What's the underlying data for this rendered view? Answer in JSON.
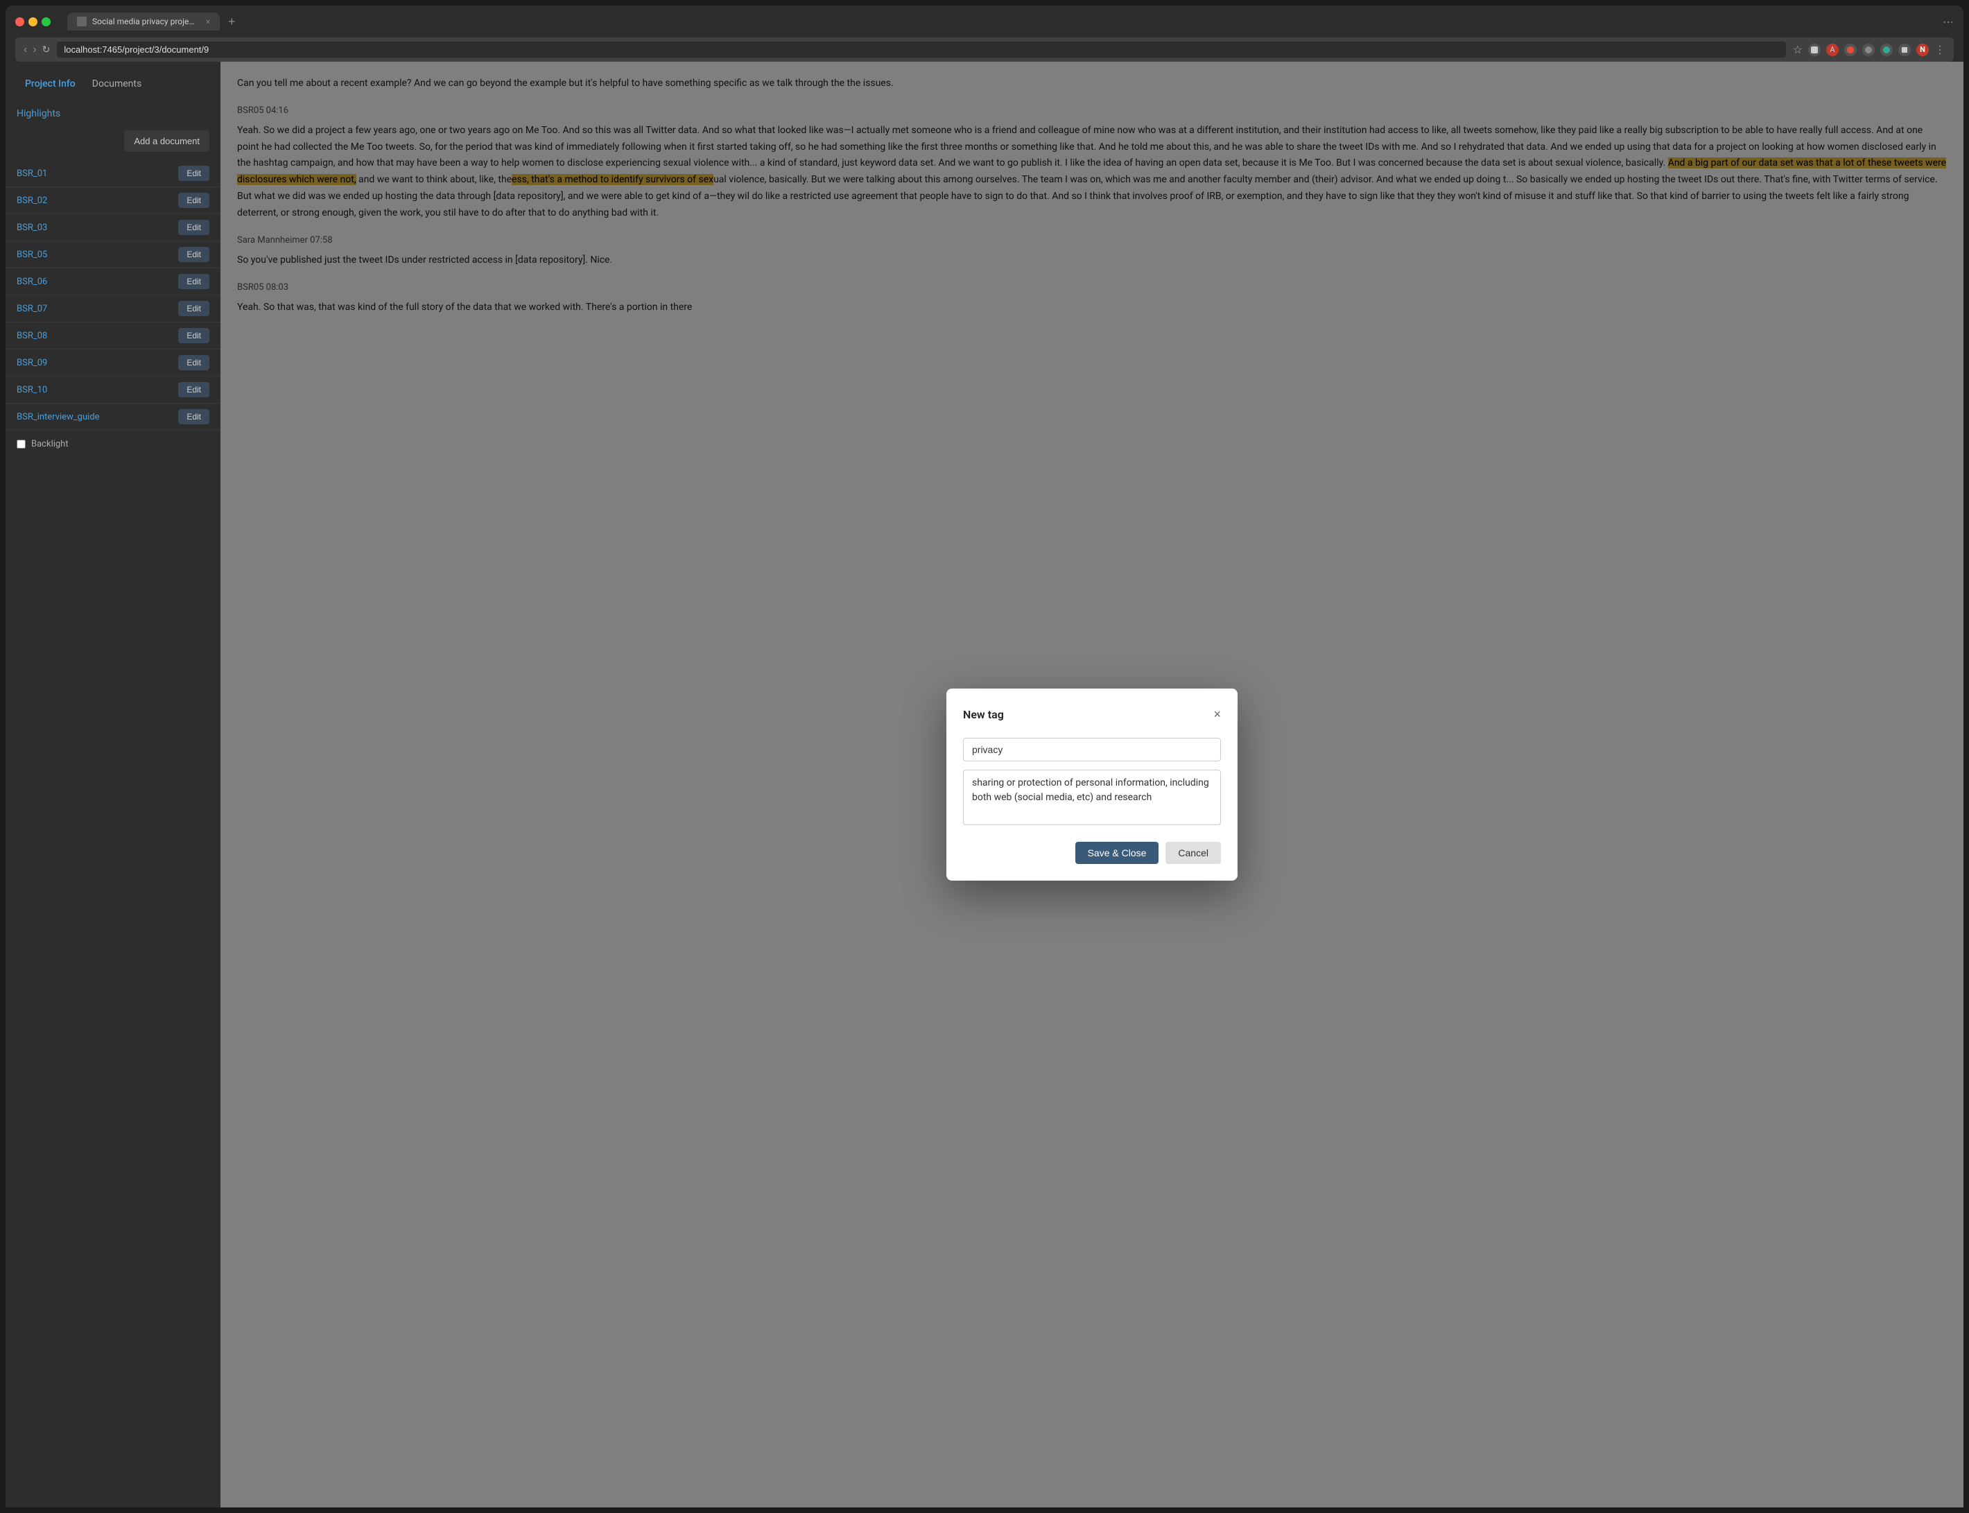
{
  "browser": {
    "tab_title": "Social media privacy project |",
    "url": "localhost:7465/project/3/document/9",
    "tab_close_label": "×",
    "tab_new_label": "+",
    "more_label": "⋯",
    "nav_back": "‹",
    "nav_forward": "›",
    "nav_refresh": "↻",
    "bookmark_label": "☆",
    "avatar_label": "N"
  },
  "sidebar": {
    "nav_project_info": "Project Info",
    "nav_documents": "Documents",
    "highlights_label": "Highlights",
    "add_document_label": "Add a document",
    "documents": [
      {
        "name": "BSR_01",
        "edit_label": "Edit"
      },
      {
        "name": "BSR_02",
        "edit_label": "Edit"
      },
      {
        "name": "BSR_03",
        "edit_label": "Edit"
      },
      {
        "name": "BSR_05",
        "edit_label": "Edit"
      },
      {
        "name": "BSR_06",
        "edit_label": "Edit"
      },
      {
        "name": "BSR_07",
        "edit_label": "Edit"
      },
      {
        "name": "BSR_08",
        "edit_label": "Edit"
      },
      {
        "name": "BSR_09",
        "edit_label": "Edit"
      },
      {
        "name": "BSR_10",
        "edit_label": "Edit"
      },
      {
        "name": "BSR_interview_guide",
        "edit_label": "Edit"
      }
    ],
    "backlight_label": "Backlight"
  },
  "transcript": {
    "blocks": [
      {
        "id": "t1",
        "speaker": "",
        "text": "Can you tell me about a recent example? And we can go beyond the example but it's helpful to have something specific as we talk through the the issues."
      },
      {
        "id": "t2",
        "speaker": "BSR05 04:16",
        "text_before": "Yeah. So we did a project a few years ago, one or two years ago on Me Too. And so this was all Twitter data. And so what that looked like was—I actually met someone who is a friend and colleague of mine now who was at a different institution, and their institution had access to like, all tweets somehow, like they paid like a really big subscription to be able to have really full access. And at one point he had collected the Me Too tweets. So, for the period that was kind of immediately following when it first started taking off, so he had something like the first three months or something like that. And he told me about this, and he was able to share the tweet IDs with me. And so I rehydrated that data. And we ended up using that data for a project on looking at how women disclosed early in the hashtag campaign, and how that may have been a way to help women to disclose experiencing sexual violence with... a kind of standard, just keyword data set. And we want to go publish it. I like the idea of having an open data set, because it is Me Too. But I was concerned because the data set is about sexual violence, basically. ",
        "highlight1": "And a big part of our data set was that a lot of these tweets were disclosures which were not,",
        "text_middle": " and we want to think about, like, the",
        "highlight2": "ess, that's a method to identify survivors of sex",
        "text_after": "ual violence, basically. But we were talking about this among ourselves. The team I was on, which was me and another faculty member and (their) advisor. And what we ended up doing t... So basically we ended up hosting the tweet IDs out there. That's fine, with Twitter terms of service. But what we did was we ended up hosting the data through [data repository], and we were able to get kind of a—they wil do like a restricted use agreement that people have to sign to do that. And so I think that involves proof of IRB, or exemption, and they have to sign like that they they won't kind of misuse it and stuff like that. So that kind of barrier to using the tweets felt like a fairly strong deterrent, or strong enough, given the work, you stil have to do after that to do anything bad with it."
      },
      {
        "id": "t3",
        "speaker": "Sara Mannheimer 07:58",
        "text": "So you've published just the tweet IDs under restricted access in [data repository]. Nice."
      },
      {
        "id": "t4",
        "speaker": "BSR05 08:03",
        "text": "Yeah. So that was, that was kind of the full story of the data that we worked with. There's a portion in there"
      }
    ]
  },
  "modal": {
    "title": "New tag",
    "close_label": "×",
    "tag_name_value": "privacy",
    "tag_name_placeholder": "",
    "tag_description_value": "sharing or protection of personal information, including both web (social media, etc) and research",
    "save_label": "Save & Close",
    "cancel_label": "Cancel"
  }
}
